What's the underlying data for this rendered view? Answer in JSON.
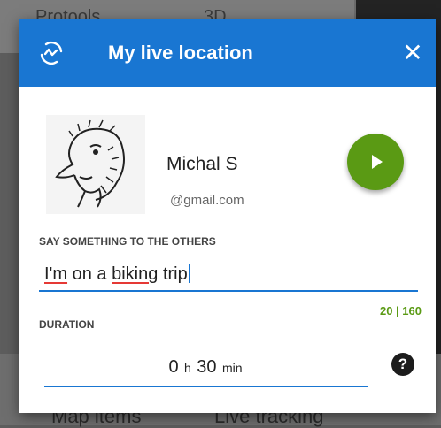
{
  "background": {
    "top_left_text": "Protools",
    "top_right_text": "3D",
    "bottom_left_text": "Map items",
    "bottom_right_text": "Live tracking"
  },
  "dialog": {
    "title": "My live location",
    "header_icon": "live-location-icon",
    "close_icon": "close-icon",
    "user_name": "Michal S",
    "user_email": "@gmail.com",
    "play_icon": "play-icon",
    "message_label": "SAY SOMETHING TO THE OTHERS",
    "message_words": {
      "w1": "I'm",
      "w2": "on a",
      "w3": "biking",
      "w4": "trip"
    },
    "char_count": "20 | 160",
    "duration_label": "DURATION",
    "duration": {
      "hours": "0",
      "hours_unit": "h",
      "minutes": "30",
      "minutes_unit": "min"
    },
    "help_icon": "?"
  },
  "colors": {
    "header": "#1976d2",
    "accent_green": "#5a9a14",
    "underline": "#1976d2",
    "spell_error": "#e53935"
  }
}
